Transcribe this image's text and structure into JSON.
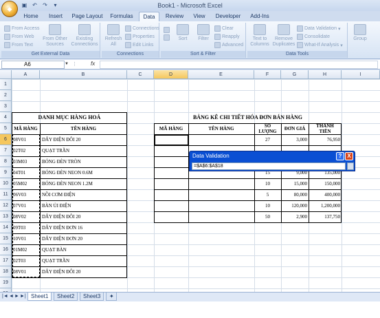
{
  "window": {
    "title": "Book1 - Microsoft Excel"
  },
  "ribbon": {
    "tabs": [
      "Home",
      "Insert",
      "Page Layout",
      "Formulas",
      "Data",
      "Review",
      "View",
      "Developer",
      "Add-Ins"
    ],
    "active_tab": "Data",
    "groups": {
      "external": {
        "label": "Get External Data",
        "from_access": "From Access",
        "from_web": "From Web",
        "from_text": "From Text",
        "from_other_1": "From Other",
        "from_other_2": "Sources",
        "existing_1": "Existing",
        "existing_2": "Connections"
      },
      "connections": {
        "label": "Connections",
        "refresh_1": "Refresh",
        "refresh_2": "All",
        "connections": "Connections",
        "properties": "Properties",
        "edit_links": "Edit Links"
      },
      "sort_filter": {
        "label": "Sort & Filter",
        "sort": "Sort",
        "filter": "Filter",
        "clear": "Clear",
        "reapply": "Reapply",
        "advanced": "Advanced"
      },
      "data_tools": {
        "label": "Data Tools",
        "text_to_1": "Text to",
        "text_to_2": "Columns",
        "remove_1": "Remove",
        "remove_2": "Duplicates",
        "validation": "Data Validation",
        "consolidate": "Consolidate",
        "whatif": "What-If Analysis"
      },
      "outline": {
        "group_label": "Group"
      }
    }
  },
  "formula_bar": {
    "name_box": "A6",
    "fx": "fx",
    "value": ""
  },
  "columns": [
    "A",
    "B",
    "C",
    "D",
    "E",
    "F",
    "G",
    "H",
    "I"
  ],
  "rows": [
    "1",
    "2",
    "3",
    "4",
    "5",
    "6",
    "7",
    "8",
    "9",
    "10",
    "11",
    "12",
    "13",
    "14",
    "15",
    "16",
    "17",
    "18",
    "19",
    "20",
    "21"
  ],
  "left_table": {
    "title": "DANH MỤC HÀNG HOÁ",
    "header_code": "MÃ HÀNG",
    "header_name": "TÊN HÀNG",
    "rows": [
      {
        "code": "08V01",
        "name": "DÂY ĐIỆN ĐÔI 20"
      },
      {
        "code": "02T02",
        "name": "QUẠT TRẦN"
      },
      {
        "code": "03M03",
        "name": "BÓNG ĐÈN TRÒN"
      },
      {
        "code": "04T01",
        "name": "BÓNG ĐÈN NEON 0.6M"
      },
      {
        "code": "05M02",
        "name": "BÓNG ĐÈN NEON 1.2M"
      },
      {
        "code": "06V03",
        "name": "NỒI CƠM ĐIỆN"
      },
      {
        "code": "07V01",
        "name": "BÀN ỦI ĐIỆN"
      },
      {
        "code": "08V02",
        "name": "DÂY ĐIỆN ĐÔI 20"
      },
      {
        "code": "09T03",
        "name": "DÂY ĐIỆN ĐƠN 16"
      },
      {
        "code": "10V01",
        "name": "DÂY ĐIỆN ĐƠN 20"
      },
      {
        "code": "01M02",
        "name": "QUẠT BÀN"
      },
      {
        "code": "02T03",
        "name": "QUẠT TRẦN"
      },
      {
        "code": "08V01",
        "name": "DÂY ĐIỆN ĐÔI 20"
      }
    ]
  },
  "right_table": {
    "title": "BẢNG KÊ CHI TIẾT HÓA ĐƠN BÁN HÀNG",
    "header_code": "MÃ HÀNG",
    "header_name": "TÊN HÀNG",
    "header_qty_1": "SỐ",
    "header_qty_2": "LƯỢNG",
    "header_price": "ĐƠN GIÁ",
    "header_total_1": "THÀNH",
    "header_total_2": "TIỀN",
    "rows": [
      {
        "qty": "27",
        "price": "3,000",
        "total": "76,950"
      },
      {
        "qty": "",
        "price": "",
        "total": ""
      },
      {
        "qty": "",
        "price": "",
        "total": ""
      },
      {
        "qty": "15",
        "price": "9,000",
        "total": "135,000"
      },
      {
        "qty": "10",
        "price": "15,000",
        "total": "150,000"
      },
      {
        "qty": "5",
        "price": "80,000",
        "total": "400,000"
      },
      {
        "qty": "10",
        "price": "120,000",
        "total": "1,200,000"
      },
      {
        "qty": "50",
        "price": "2,900",
        "total": "137,750"
      }
    ]
  },
  "dialog": {
    "title": "Data Validation",
    "help": "?",
    "close": "X",
    "value": "=$A$6:$A$18"
  },
  "sheets": {
    "tabs": [
      "Sheet1",
      "Sheet2",
      "Sheet3"
    ],
    "active": "Sheet1",
    "nav": [
      "|◄",
      "◄",
      "►",
      "►|"
    ]
  }
}
